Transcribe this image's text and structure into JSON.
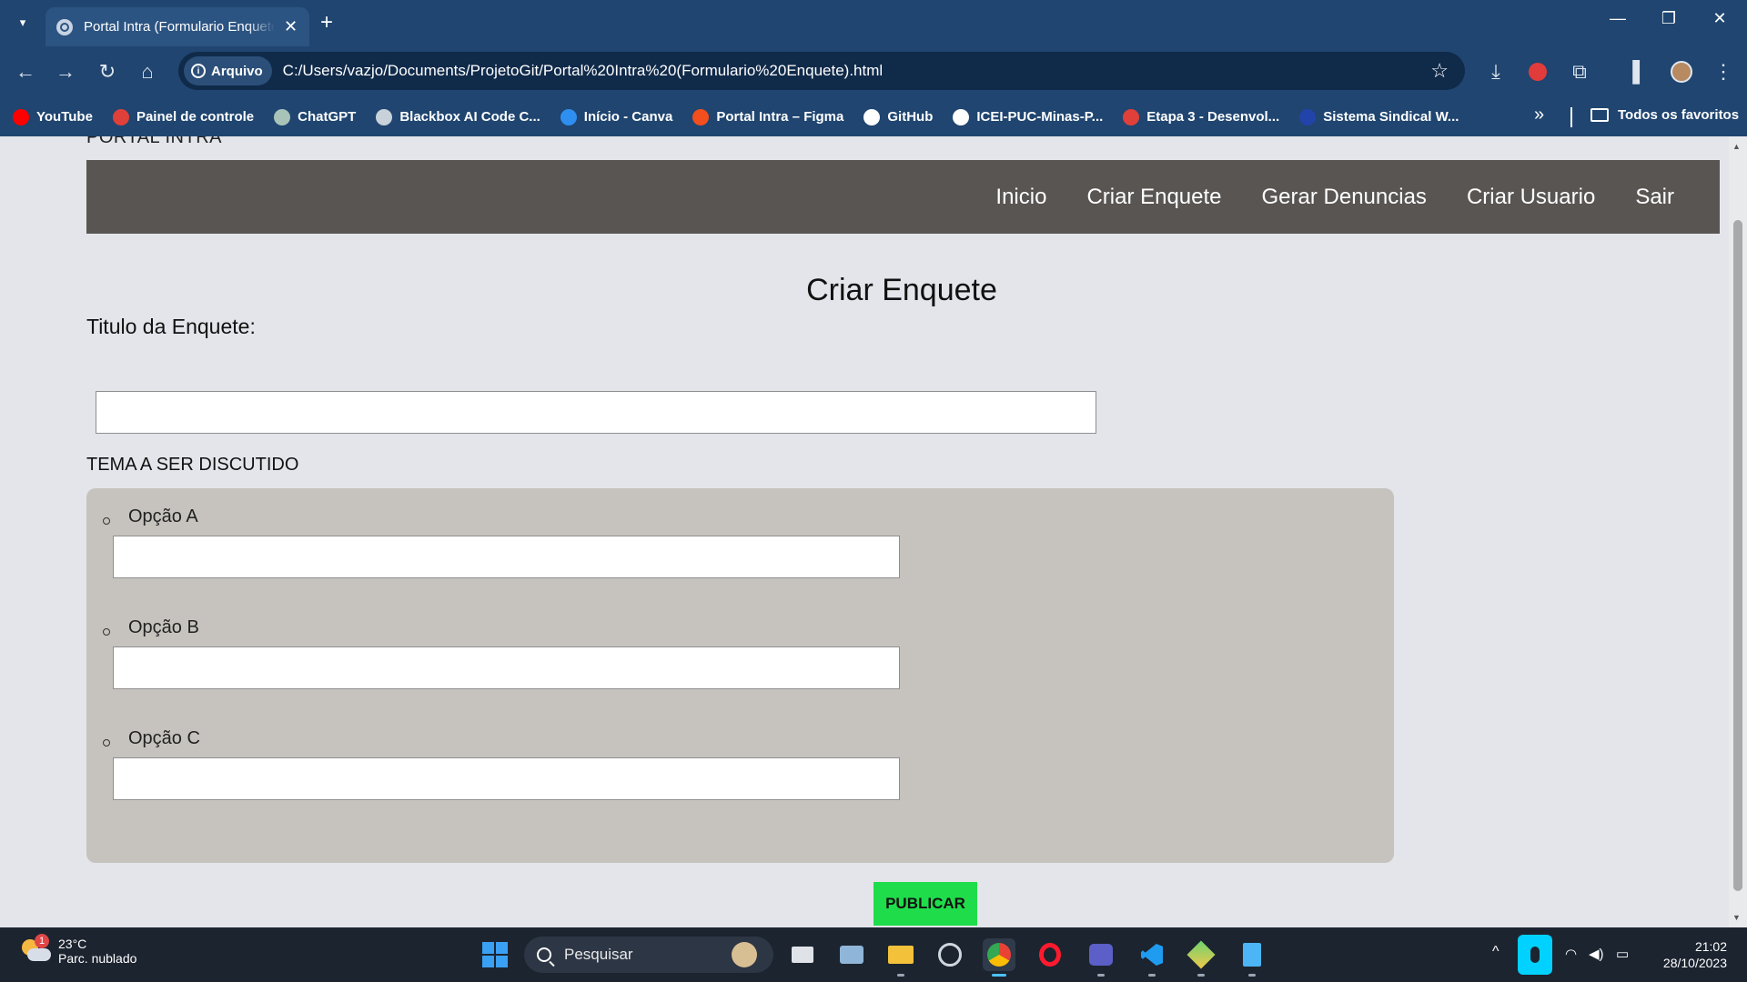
{
  "browser": {
    "tab_title": "Portal Intra (Formulario Enquete)",
    "new_tab": "+",
    "tab_close": "✕",
    "minimize": "—",
    "restore": "❐",
    "close": "✕",
    "chip_label": "Arquivo",
    "url": "C:/Users/vazjo/Documents/ProjetoGit/Portal%20Intra%20(Formulario%20Enquete).html",
    "bookmarks": [
      {
        "label": "YouTube",
        "color": "#ff0000"
      },
      {
        "label": "Painel de controle",
        "color": "#e0403a"
      },
      {
        "label": "ChatGPT",
        "color": "#a8c4b8"
      },
      {
        "label": "Blackbox AI Code C...",
        "color": "#c9d1da"
      },
      {
        "label": "Início - Canva",
        "color": "#2f8ff0"
      },
      {
        "label": "Portal Intra – Figma",
        "color": "#f24e1e"
      },
      {
        "label": "GitHub",
        "color": "#ffffff"
      },
      {
        "label": "ICEI-PUC-Minas-P...",
        "color": "#ffffff"
      },
      {
        "label": "Etapa 3 - Desenvol...",
        "color": "#e0403a"
      },
      {
        "label": "Sistema Sindical W...",
        "color": "#2244aa"
      }
    ],
    "bookmarks_more": "»",
    "all_bookmarks": "Todos os favoritos"
  },
  "page": {
    "brand": "PORTAL INTRA",
    "nav": [
      "Inicio",
      "Criar Enquete",
      "Gerar Denuncias",
      "Criar Usuario",
      "Sair"
    ],
    "title": "Criar Enquete",
    "title_label": "Titulo da Enquete:",
    "title_value": "",
    "theme_label": "TEMA A SER DISCUTIDO",
    "options": [
      {
        "label": "Opção A",
        "value": ""
      },
      {
        "label": "Opção B",
        "value": ""
      },
      {
        "label": "Opção C",
        "value": ""
      }
    ],
    "publish": "PUBLICAR"
  },
  "taskbar": {
    "weather_temp": "23°C",
    "weather_desc": "Parc. nublado",
    "weather_badge": "1",
    "search_placeholder": "Pesquisar",
    "time": "21:02",
    "date": "28/10/2023"
  }
}
